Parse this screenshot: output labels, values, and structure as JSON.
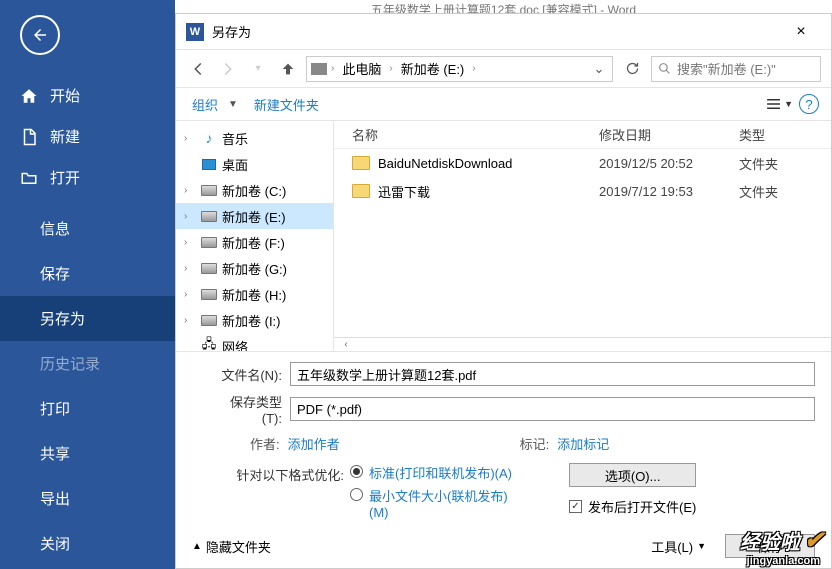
{
  "word_title_hint": "五年级数学上册计算题12套.doc [兼容模式] - Word",
  "sidebar": {
    "home": "开始",
    "new": "新建",
    "open": "打开",
    "info": "信息",
    "save": "保存",
    "saveas": "另存为",
    "history": "历史记录",
    "print": "打印",
    "share": "共享",
    "export": "导出",
    "close": "关闭"
  },
  "dialog": {
    "title": "另存为",
    "breadcrumb": {
      "pc": "此电脑",
      "drive": "新加卷 (E:)"
    },
    "search_placeholder": "搜索\"新加卷 (E:)\"",
    "organize": "组织",
    "newfolder": "新建文件夹",
    "tree": {
      "music": "音乐",
      "desktop": "桌面",
      "c": "新加卷 (C:)",
      "e": "新加卷 (E:)",
      "f": "新加卷 (F:)",
      "g": "新加卷 (G:)",
      "h": "新加卷 (H:)",
      "i": "新加卷 (I:)",
      "net": "网络"
    },
    "headers": {
      "name": "名称",
      "date": "修改日期",
      "type": "类型"
    },
    "rows": [
      {
        "name": "BaiduNetdiskDownload",
        "date": "2019/12/5 20:52",
        "type": "文件夹"
      },
      {
        "name": "迅雷下载",
        "date": "2019/7/12 19:53",
        "type": "文件夹"
      }
    ],
    "filename_label": "文件名(N):",
    "filename_value": "五年级数学上册计算题12套.pdf",
    "filetype_label": "保存类型(T):",
    "filetype_value": "PDF (*.pdf)",
    "author_label": "作者:",
    "author_link": "添加作者",
    "tag_label": "标记:",
    "tag_link": "添加标记",
    "optimize_label": "针对以下格式优化:",
    "radio_standard": "标准(打印和联机发布)(A)",
    "radio_min": "最小文件大小(联机发布)(M)",
    "options_btn": "选项(O)...",
    "open_after": "发布后打开文件(E)",
    "hide_folders": "隐藏文件夹",
    "tools": "工具(L)",
    "save_btn": "保存",
    "close_x": "×"
  },
  "watermark": {
    "main": "经验啦",
    "sub": "jingyanla.com"
  }
}
